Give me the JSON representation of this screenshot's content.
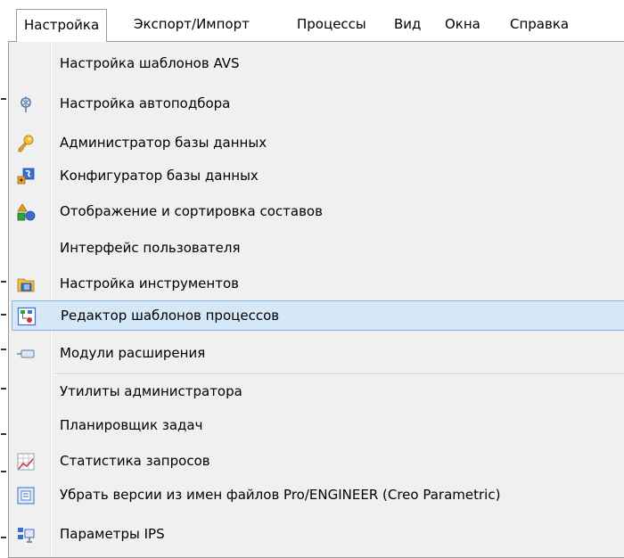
{
  "menubar": {
    "items": [
      {
        "label": "Настройка",
        "active": true
      },
      {
        "label": "Экспорт/Импорт"
      },
      {
        "label": "Процессы"
      },
      {
        "label": "Вид"
      },
      {
        "label": "Окна"
      },
      {
        "label": "Справка"
      }
    ]
  },
  "dropdown": {
    "items": [
      {
        "label": "Настройка шаблонов AVS",
        "icon": "none"
      },
      {
        "label": "Настройка автоподбора",
        "icon": "autoselect-icon"
      },
      {
        "label": "Администратор базы данных",
        "icon": "key-icon"
      },
      {
        "label": "Конфигуратор базы данных",
        "icon": "db-configurator-icon"
      },
      {
        "label": "Отображение и сортировка составов",
        "icon": "shapes-icon"
      },
      {
        "label": "Интерфейс пользователя",
        "icon": "none"
      },
      {
        "label": "Настройка инструментов",
        "icon": "tools-icon"
      },
      {
        "label": "Редактор шаблонов процессов",
        "icon": "process-template-icon",
        "highlighted": true
      },
      {
        "label": "Модули расширения",
        "icon": "plugin-icon",
        "submenu": true
      },
      {
        "label": "Утилиты администратора",
        "icon": "none",
        "submenu": true
      },
      {
        "label": "Планировщик задач",
        "icon": "none"
      },
      {
        "label": "Статистика запросов",
        "icon": "stats-icon"
      },
      {
        "label": "Убрать версии из имен файлов Pro/ENGINEER (Creo Parametric)",
        "icon": "remove-version-icon"
      },
      {
        "label": "Параметры IPS",
        "icon": "ips-params-icon"
      }
    ]
  },
  "colors": {
    "menu_bg": "#f0f0f0",
    "highlight_bg": "#d5e8f8",
    "highlight_border": "#7fb6e6"
  }
}
